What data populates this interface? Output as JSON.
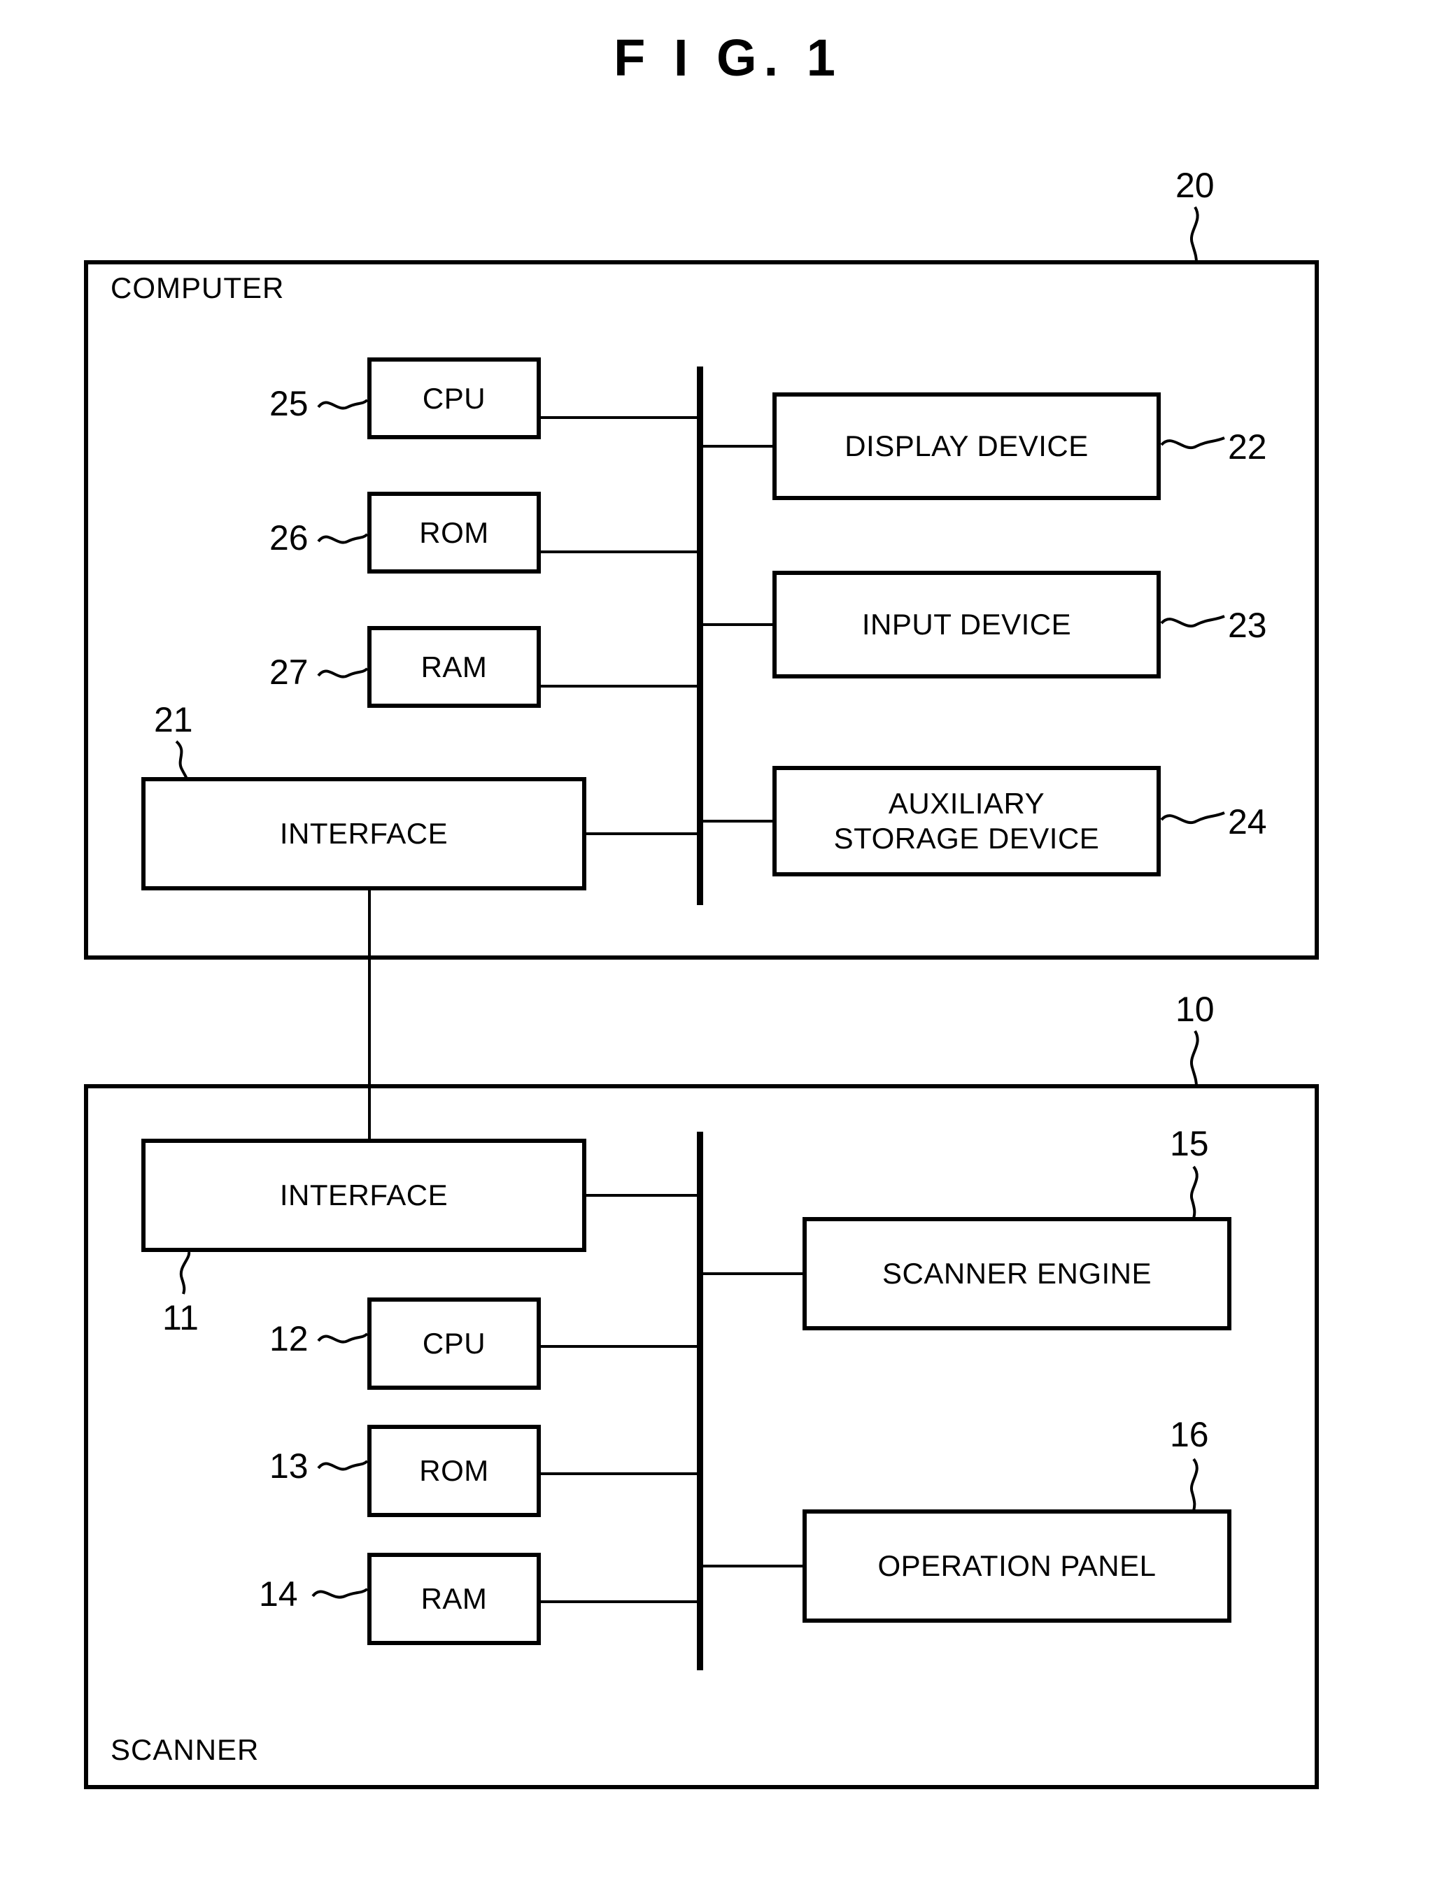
{
  "figure": {
    "title": "F I G. 1",
    "type": "patent-block-diagram"
  },
  "computer_system": {
    "enclosure_label": "COMPUTER",
    "reference_numeral": "20",
    "left_column": [
      {
        "label": "CPU",
        "reference_numeral": "25"
      },
      {
        "label": "ROM",
        "reference_numeral": "26"
      },
      {
        "label": "RAM",
        "reference_numeral": "27"
      }
    ],
    "interface": {
      "label": "INTERFACE",
      "reference_numeral": "21"
    },
    "right_column": [
      {
        "label": "DISPLAY DEVICE",
        "reference_numeral": "22"
      },
      {
        "label": "INPUT DEVICE",
        "reference_numeral": "23"
      },
      {
        "label_line1": "AUXILIARY",
        "label_line2": "STORAGE DEVICE",
        "reference_numeral": "24"
      }
    ]
  },
  "scanner_system": {
    "enclosure_label": "SCANNER",
    "reference_numeral": "10",
    "interface": {
      "label": "INTERFACE",
      "reference_numeral": "11"
    },
    "left_column": [
      {
        "label": "CPU",
        "reference_numeral": "12"
      },
      {
        "label": "ROM",
        "reference_numeral": "13"
      },
      {
        "label": "RAM",
        "reference_numeral": "14"
      }
    ],
    "right_column": [
      {
        "label": "SCANNER ENGINE",
        "reference_numeral": "15"
      },
      {
        "label": "OPERATION PANEL",
        "reference_numeral": "16"
      }
    ]
  },
  "colors": {
    "ink": "#000000",
    "paper": "#ffffff"
  }
}
